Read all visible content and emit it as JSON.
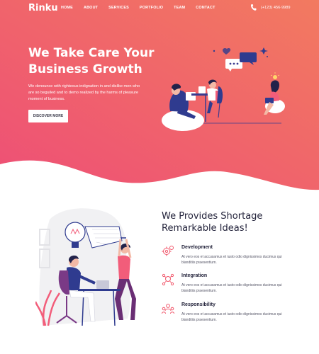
{
  "brand": "Rinku",
  "nav": {
    "items": [
      {
        "label": "HOME"
      },
      {
        "label": "ABOUT"
      },
      {
        "label": "SERVICES"
      },
      {
        "label": "PORTFOLIO"
      },
      {
        "label": "TEAM"
      },
      {
        "label": "CONTACT"
      }
    ],
    "phone": "(+123) 456-9989",
    "phone_icon": "phone-icon"
  },
  "hero": {
    "title_line1": "We Take Care Your",
    "title_line2": "Business Growth",
    "description": "We denounce with righteous indignation in and dislike men who are so beguiled and to demo realized by the harms of pleasure moment of business.",
    "button_label": "DISCOVER MORE",
    "gradient_colors": [
      "#f05a7e",
      "#f07a62"
    ]
  },
  "ideas": {
    "title_line1": "We Provides Shortage",
    "title_line2": "Remarkable Ideas!",
    "features": [
      {
        "title": "Development",
        "icon": "gears-icon",
        "description": "At vero eos et accusamus et iusto odio dignissimos ducimus qui blanditiis praesentium."
      },
      {
        "title": "Integration",
        "icon": "network-icon",
        "description": "At vero eos et accusamus et iusto odio dignissimos ducimus qui blanditiis praesentium."
      },
      {
        "title": "Responsibility",
        "icon": "team-icon",
        "description": "At vero eos et accusamus et iusto odio dignissimos ducimus qui blanditiis praesentium."
      }
    ]
  },
  "colors": {
    "accent": "#f15a6e",
    "heading": "#22223a"
  }
}
